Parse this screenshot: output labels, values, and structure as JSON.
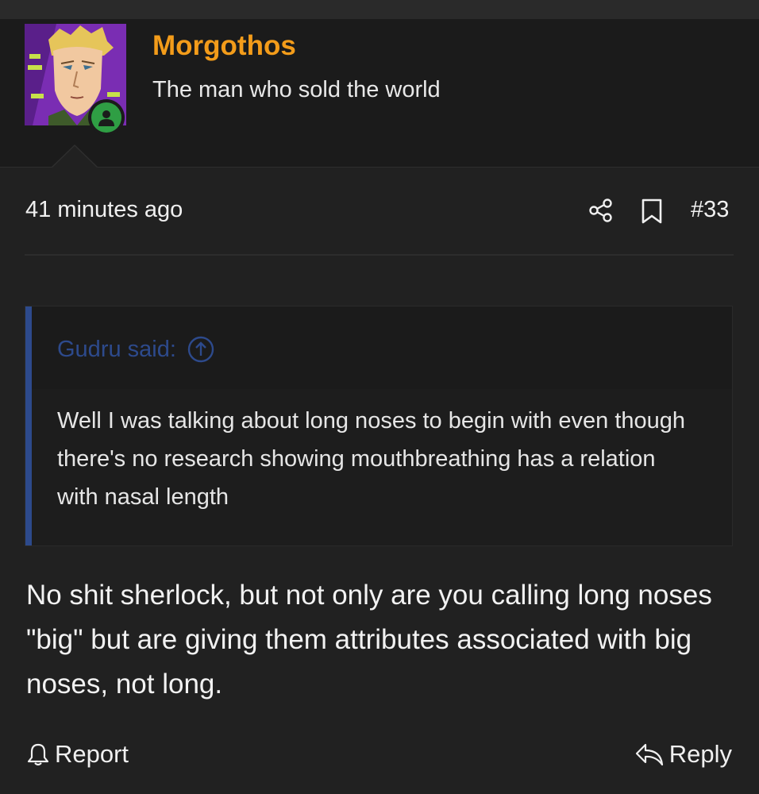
{
  "user": {
    "name": "Morgothos",
    "title": "The man who sold the world",
    "status": "online"
  },
  "post": {
    "time": "41 minutes ago",
    "number": "#33",
    "body": "No shit sherlock, but not only are you calling long noses \"big\" but are giving them attributes associated with big noses, not long."
  },
  "quote": {
    "attribution": "Gudru said:",
    "text": "Well I was talking about long noses to begin with even though there's no research showing mouthbreathing has a relation with nasal length"
  },
  "actions": {
    "report_label": "Report",
    "reply_label": "Reply"
  },
  "icons": {
    "share": "share-icon",
    "bookmark": "bookmark-icon",
    "quote_jump": "arrow-up-circle-icon",
    "report": "bell-icon",
    "reply": "reply-icon",
    "online": "user-icon"
  },
  "colors": {
    "username": "#f39c1a",
    "quote_accent": "#2d4a8c",
    "online": "#2f9e44",
    "background": "#212121"
  }
}
